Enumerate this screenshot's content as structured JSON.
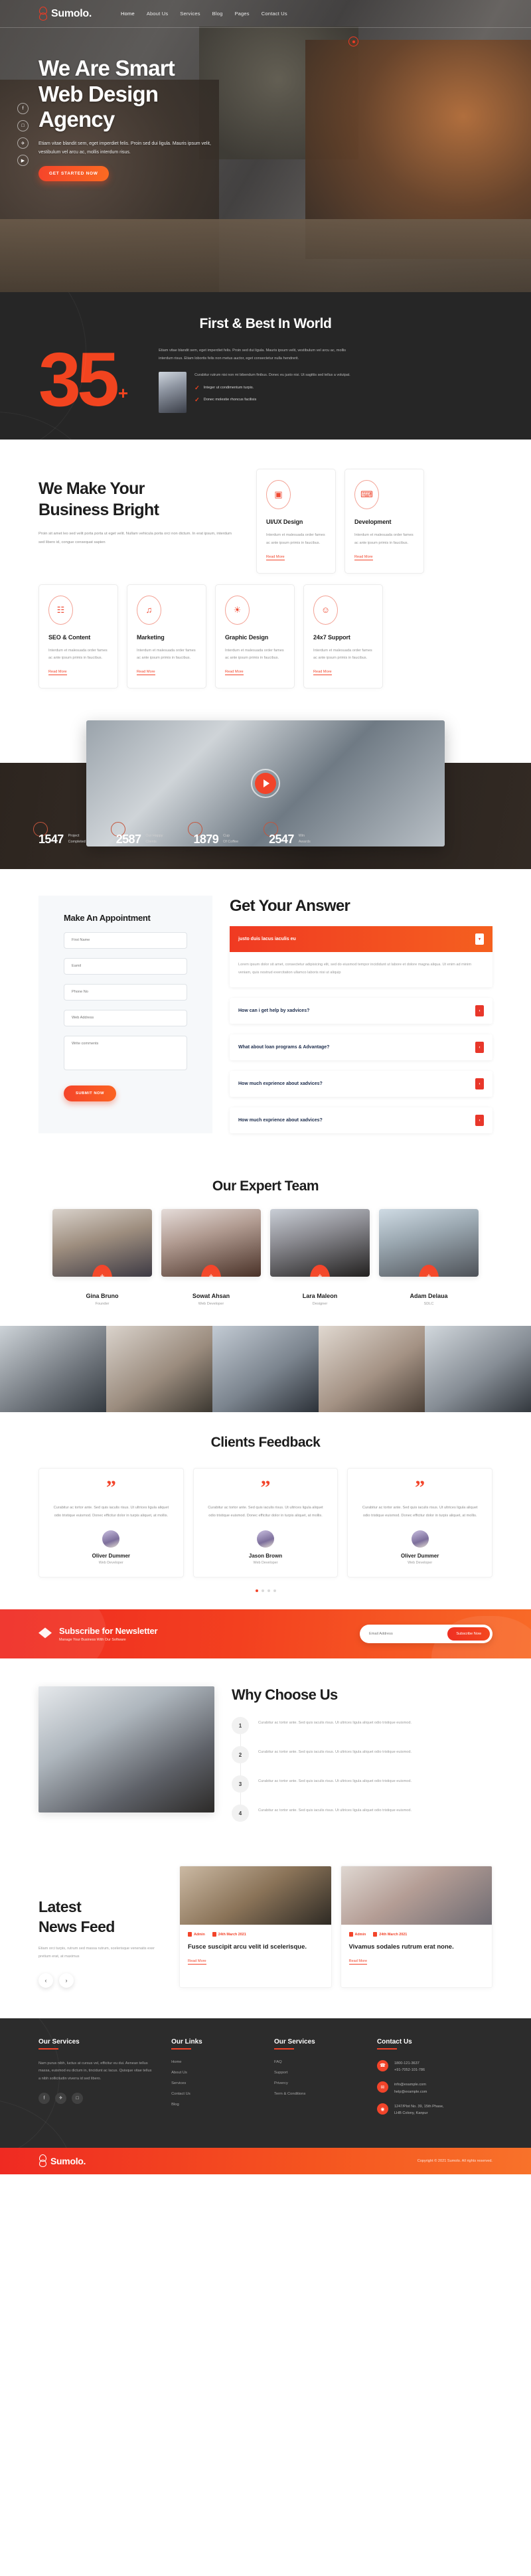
{
  "brand": {
    "name": "Sumolo.",
    "logo_icon": "sumolo-logo-icon"
  },
  "nav": {
    "items": [
      {
        "label": "Home",
        "active": true
      },
      {
        "label": "About Us",
        "active": false
      },
      {
        "label": "Services",
        "active": false
      },
      {
        "label": "Blog",
        "active": false
      },
      {
        "label": "Pages",
        "active": false
      },
      {
        "label": "Contact Us",
        "active": false
      }
    ]
  },
  "hero": {
    "heading_line1": "We Are Smart",
    "heading_line2": "Web Design",
    "heading_line3": "Agency",
    "paragraph": "Etiam vitae blandit sem, eget imperdiet felis. Proin sed dui ligula. Mauris ipsum velit, vestibulum vel arcu ac, mollis interdum risus.",
    "cta": "GET STARTED NOW",
    "social": [
      {
        "icon": "facebook-icon",
        "glyph": "f"
      },
      {
        "icon": "instagram-icon",
        "glyph": "□"
      },
      {
        "icon": "twitter-icon",
        "glyph": "✈"
      },
      {
        "icon": "youtube-icon",
        "glyph": "▶"
      }
    ]
  },
  "stats": {
    "title": "First & Best In World",
    "number": "35",
    "plus": "+",
    "paragraph": "Etiam vitae blandit sem, eget imperdiet felis. Proin sed dui ligula. Mauris ipsum velit, vestibulum vel arcu ac, mollis interdum risus. Etiam lobortis felis non metus auctor, eget consectetur nulla hendrerit.",
    "sub_paragraph": "Curabitur rutrum nisi non mi bibendum finibus. Donec eu justo nisi. Ut sagittis sed tellus a volutpat.",
    "checks": [
      "Integer ut condimentum turpis.",
      "Donec molestie rhoncus facilisis"
    ]
  },
  "services": {
    "heading_line1": "We Make Your",
    "heading_line2": "Business Bright",
    "paragraph": "Proin sit amet leo sed velit porta porta ut eget velit. Nullam vehicula porta orci non dictum. In erat ipsum, interdum sed libero id, congue consequat sapien",
    "read_more": "Read More",
    "card_text": "Interdum et malesuada order fames ac ante ipsum primis in faucibus.",
    "cards_top": [
      {
        "title": "UI/UX Design",
        "icon": "mobile-design-icon",
        "glyph": "▣"
      },
      {
        "title": "Development",
        "icon": "code-window-icon",
        "glyph": "⌨"
      }
    ],
    "cards_bottom": [
      {
        "title": "SEO & Content",
        "icon": "seo-chart-icon",
        "glyph": "☷"
      },
      {
        "title": "Marketing",
        "icon": "megaphone-icon",
        "glyph": "♫"
      },
      {
        "title": "Graphic Design",
        "icon": "lightbulb-icon",
        "glyph": "☀"
      },
      {
        "title": "24x7 Support",
        "icon": "headset-support-icon",
        "glyph": "☺"
      }
    ]
  },
  "video": {
    "play_icon": "play-button-icon"
  },
  "counters": [
    {
      "number": "1547",
      "label_line1": "Project",
      "label_line2": "Completed"
    },
    {
      "number": "2587",
      "label_line1": "Our Happy",
      "label_line2": "Clients"
    },
    {
      "number": "1879",
      "label_line1": "Cup",
      "label_line2": "Of Coffee"
    },
    {
      "number": "2547",
      "label_line1": "Win",
      "label_line2": "Awards"
    }
  ],
  "appointment": {
    "title": "Make An Appointment",
    "fields": [
      {
        "name": "first-name-field",
        "placeholder": "First Name"
      },
      {
        "name": "email-field",
        "placeholder": "Eamil"
      },
      {
        "name": "phone-field",
        "placeholder": "Phone No"
      },
      {
        "name": "website-field",
        "placeholder": "Web Address"
      }
    ],
    "comment_placeholder": "Write comments",
    "submit": "SUBMIT NOW"
  },
  "faq": {
    "title": "Get Your Answer",
    "items": [
      {
        "question": "justo duis lacus iaculis eu",
        "open": true,
        "answer": "Lorem ipsum dolor sit amet, consectetur adipisicing elit, sed do eiusmod tempor incididunt ut labore et dolore magna aliqua. Ut enim ad minim veniam, quis nostrud exercitation ullamco laboris nisi ut aliquip"
      },
      {
        "question": "How can i get help by xadvices?",
        "open": false,
        "answer": ""
      },
      {
        "question": "What about loan programs & Advantage?",
        "open": false,
        "answer": ""
      },
      {
        "question": "How much exprience about xadvices?",
        "open": false,
        "answer": ""
      },
      {
        "question": "How much exprience about xadvices?",
        "open": false,
        "answer": ""
      }
    ]
  },
  "team": {
    "title": "Our Expert Team",
    "members": [
      {
        "name": "Gina Bruno",
        "role": "Founder"
      },
      {
        "name": "Sowat Ahsan",
        "role": "Web Developer"
      },
      {
        "name": "Lara Maleon",
        "role": "Designer"
      },
      {
        "name": "Adam Delaua",
        "role": "SDLC"
      }
    ]
  },
  "feedback": {
    "title": "Clients Feedback",
    "quote_icon": "quotation-mark-icon",
    "cards": [
      {
        "text": "Curabitur ac tortor ante. Sed quis iaculis risus. Ut ultrices ligula aliquet odio tristique euismod. Donec efficitur dolor in turpis aliquet, at mollis.",
        "name": "Oliver Dummer",
        "role": "Web Developer"
      },
      {
        "text": "Curabitur ac tortor ante. Sed quis iaculis risus. Ut ultrices ligula aliquet odio tristique euismod. Donec efficitur dolor in turpis aliquet, at mollis.",
        "name": "Jason Brown",
        "role": "Web Developer"
      },
      {
        "text": "Curabitur ac tortor ante. Sed quis iaculis risus. Ut ultrices ligula aliquet odio tristique euismod. Donec efficitur dolor in turpis aliquet, at mollis.",
        "name": "Oliver Dummer",
        "role": "Web Developer"
      }
    ],
    "active_dot": 0,
    "dot_count": 4
  },
  "newsletter": {
    "title": "Subscribe for Newsletter",
    "subtitle": "Manage Your Business With Our Software",
    "placeholder": "Email Address",
    "button": "Subscribe Now",
    "icon": "envelope-icon"
  },
  "why": {
    "title": "Why Choose Us",
    "items": [
      {
        "num": "1",
        "text": "Curabitur ac tortor ante. Sed quis iaculis risus. Ut ultrices ligula aliquet odio tristique euismod."
      },
      {
        "num": "2",
        "text": "Curabitur ac tortor ante. Sed quis iaculis risus. Ut ultrices ligula aliquet odio tristique euismod."
      },
      {
        "num": "3",
        "text": "Curabitur ac tortor ante. Sed quis iaculis risus. Ut ultrices ligula aliquet odio tristique euismod."
      },
      {
        "num": "4",
        "text": "Curabitur ac tortor ante. Sed quis iaculis risus. Ut ultrices ligula aliquet odio tristique euismod."
      }
    ]
  },
  "feed": {
    "heading_line1": "Latest",
    "heading_line2": "News Feed",
    "paragraph": "Etiam orci turpis, rutrum sed massa rutrum, scelerisque venenatis exer pretium erat, at maximus",
    "prev_icon": "chevron-left-icon",
    "next_icon": "chevron-right-icon",
    "read_more": "Read More",
    "posts": [
      {
        "author": "Admin",
        "date": "24th March 2021",
        "title": "Fusce suscipit arcu velit id scelerisque."
      },
      {
        "author": "Admin",
        "date": "24th March 2021",
        "title": "Vivamus sodales rutrum erat none."
      }
    ]
  },
  "footer": {
    "services_title": "Our Services",
    "about": "Nam purus nibh, luctus at cursus vel, efficitur eu dui. Aenean tellus massa, euismod eu dictum in, tincidunt ac lacus. Quisque vitae tellus a nibh sollicitudin viverra id sed libero.",
    "social": [
      {
        "icon": "facebook-icon",
        "glyph": "f"
      },
      {
        "icon": "twitter-icon",
        "glyph": "✈"
      },
      {
        "icon": "instagram-icon",
        "glyph": "□"
      }
    ],
    "links_title": "Our Links",
    "links": [
      "Home",
      "About Us",
      "Services",
      "Contact Us",
      "Blog"
    ],
    "services2_title": "Our Services",
    "services2": [
      "FAQ",
      "Support",
      "Privercy",
      "Term & Conditions"
    ],
    "contact_title": "Contact Us",
    "contact": [
      {
        "icon": "phone-icon",
        "glyph": "☎",
        "line1": "1800-121-3637",
        "line2": "+91-7052-101-786"
      },
      {
        "icon": "mail-icon",
        "glyph": "✉",
        "line1": "info@example.com",
        "line2": "help@example.com"
      },
      {
        "icon": "location-pin-icon",
        "glyph": "◉",
        "line1": "1247/Plot No. 39, 15th Phase,",
        "line2": "LHB Colony, Kanpur"
      }
    ],
    "copyright": "Copyright © 2021 Sumolo. All rights reserved."
  }
}
